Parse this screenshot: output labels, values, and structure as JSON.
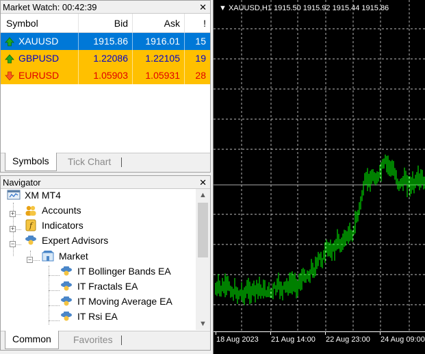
{
  "market_watch": {
    "title": "Market Watch: 00:42:39",
    "columns": {
      "symbol": "Symbol",
      "bid": "Bid",
      "ask": "Ask",
      "spread": "!"
    },
    "rows": [
      {
        "symbol": "XAUUSD",
        "bid": "1915.86",
        "ask": "1916.01",
        "spread": "15",
        "direction": "up",
        "bg": "#0078d7",
        "fg": "#ffffff"
      },
      {
        "symbol": "GBPUSD",
        "bid": "1.22086",
        "ask": "1.22105",
        "spread": "19",
        "direction": "up",
        "bg": "#ffc000",
        "fg": "#0000cc"
      },
      {
        "symbol": "EURUSD",
        "bid": "1.05903",
        "ask": "1.05931",
        "spread": "28",
        "direction": "down",
        "bg": "#ffc000",
        "fg": "#e00000"
      }
    ],
    "tabs": {
      "active": "Symbols",
      "inactive": "Tick Chart"
    }
  },
  "navigator": {
    "title": "Navigator",
    "items": [
      {
        "label": "XM MT4",
        "icon": "terminal-icon"
      },
      {
        "label": "Accounts",
        "icon": "accounts-icon"
      },
      {
        "label": "Indicators",
        "icon": "indicators-icon"
      },
      {
        "label": "Expert Advisors",
        "icon": "expert-advisors-icon"
      },
      {
        "label": "Market",
        "icon": "market-icon"
      },
      {
        "label": "IT Bollinger Bands EA",
        "icon": "expert-icon"
      },
      {
        "label": "IT Fractals EA",
        "icon": "expert-icon"
      },
      {
        "label": "IT Moving Average EA",
        "icon": "expert-icon"
      },
      {
        "label": "IT Rsi EA",
        "icon": "expert-icon"
      }
    ],
    "tabs": {
      "active": "Common",
      "inactive": "Favorites"
    }
  },
  "chart": {
    "header": "▼ XAUUSD,H1  1915.50 1915.92 1915.44 1915.86",
    "time_labels": [
      "18 Aug 2023",
      "21 Aug 14:00",
      "22 Aug 23:00",
      "24 Aug 09:00"
    ],
    "colors": {
      "background": "#000000",
      "candles": "#00ff00",
      "grid": "#ffffff"
    }
  },
  "chart_data": {
    "type": "bar",
    "symbol": "XAUUSD",
    "timeframe": "H1",
    "last_bar": {
      "open": 1915.5,
      "high": 1915.92,
      "low": 1915.44,
      "close": 1915.86
    },
    "x_labels": [
      "18 Aug 2023",
      "21 Aug 14:00",
      "22 Aug 23:00",
      "24 Aug 09:00"
    ],
    "series_shape": "sideways then sharp rally then plateau",
    "grid": true
  }
}
